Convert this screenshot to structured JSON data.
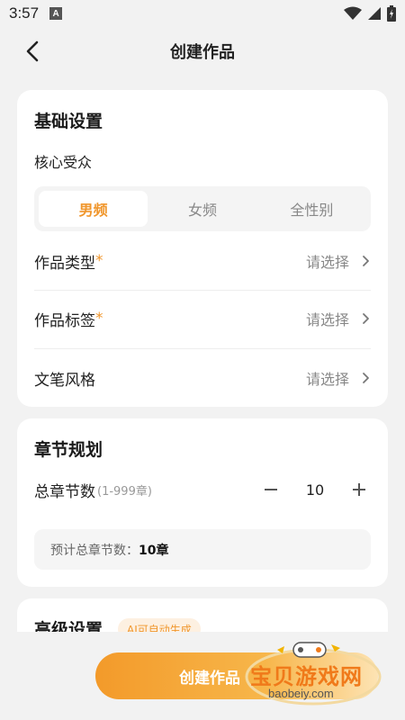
{
  "status": {
    "time": "3:57",
    "notif_letter": "A"
  },
  "nav": {
    "title": "创建作品"
  },
  "basic": {
    "title": "基础设置",
    "audience_label": "核心受众",
    "segments": [
      "男频",
      "女频",
      "全性别"
    ],
    "rows": [
      {
        "label": "作品类型",
        "required": "*",
        "value": "请选择"
      },
      {
        "label": "作品标签",
        "required": "*",
        "value": "请选择"
      },
      {
        "label": "文笔风格",
        "required": "",
        "value": "请选择"
      }
    ]
  },
  "chapter": {
    "title": "章节规划",
    "total_label": "总章节数",
    "range": "(1-999章)",
    "count": "10",
    "estimate_label": "预计总章节数：",
    "estimate_value": "10章"
  },
  "advanced": {
    "title": "高级设置",
    "badge": "AI可自动生成"
  },
  "footer": {
    "create_label": "创建作品"
  },
  "watermark": {
    "text": "宝贝游戏网",
    "url": "baobeiy.com"
  },
  "colors": {
    "accent": "#f0962c",
    "background": "#f2f2f2"
  }
}
